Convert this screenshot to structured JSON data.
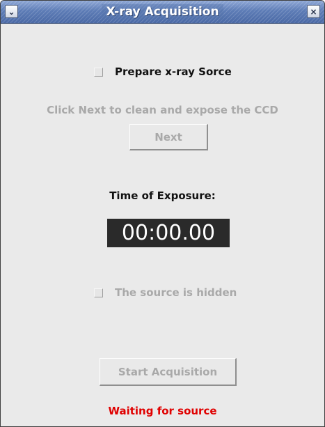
{
  "window": {
    "title": "X-ray Acquisition",
    "menu_icon": "chevron-down-icon",
    "close_icon": "close-icon"
  },
  "prepare": {
    "label": "Prepare x-ray Sorce",
    "checked": false
  },
  "instruction": "Click Next to clean and expose the CCD",
  "next_button": "Next",
  "exposure": {
    "label": "Time of Exposure:",
    "value": "00:00.00"
  },
  "source_hidden": {
    "label": "The source is hidden",
    "checked": false
  },
  "start_button": "Start Acquisition",
  "status": {
    "text": "Waiting for source",
    "color": "#e00000"
  },
  "colors": {
    "titlebar": "#5b7ab3",
    "disabled_text": "#a9a9a9",
    "timer_bg": "#2a2a2a"
  }
}
